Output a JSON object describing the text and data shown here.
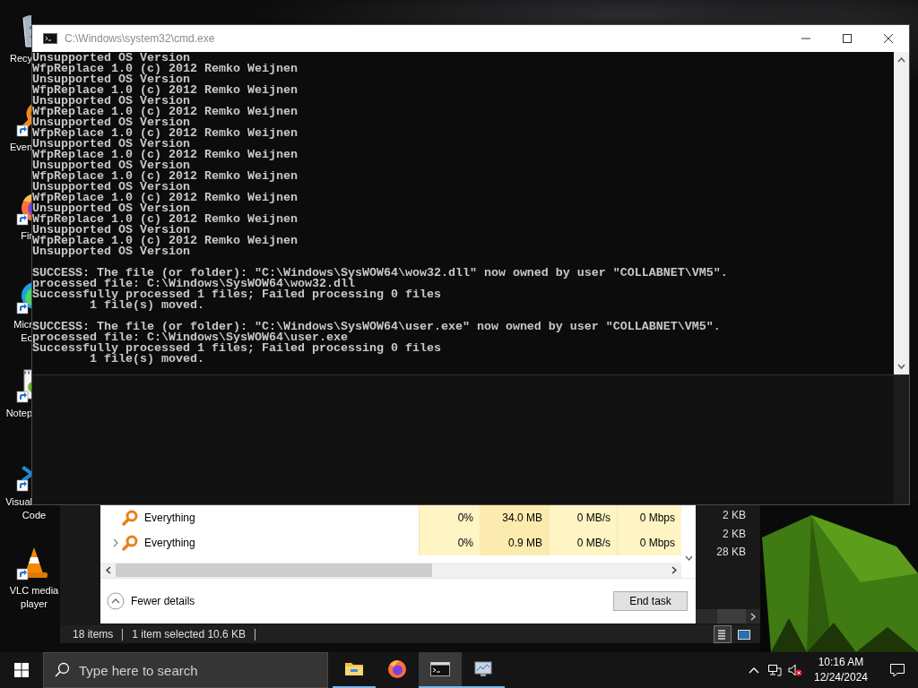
{
  "desktop_icons": [
    {
      "kind": "recycle-bin",
      "lines": [
        {
          "text": "Recy",
          "cut": true
        }
      ]
    },
    {
      "kind": "everything",
      "lines": [
        {
          "text": "Even",
          "cut": true
        }
      ]
    },
    {
      "kind": "firefox",
      "lines": [
        {
          "text": "Fir",
          "cut": true
        }
      ]
    },
    {
      "kind": "edge",
      "lines": [
        {
          "text": "Micr",
          "cut": true
        },
        {
          "text": "Ec",
          "cut": true
        }
      ]
    },
    {
      "kind": "notepad",
      "lines": [
        {
          "text": "Notep",
          "cut": true
        }
      ]
    },
    {
      "kind": "vscode",
      "lines": [
        {
          "text": "Visual",
          "cut": true
        },
        {
          "text": "Code",
          "cut": false
        }
      ]
    },
    {
      "kind": "vlc",
      "lines": [
        {
          "text": "VLC media",
          "cut": false
        },
        {
          "text": "player",
          "cut": false
        }
      ]
    }
  ],
  "cmd_window": {
    "title": "C:\\Windows\\system32\\cmd.exe",
    "blocks": [
      [
        "Unsupported OS Version",
        "WfpReplace 1.0 (c) 2012 Remko Weijnen",
        "Unsupported OS Version",
        "WfpReplace 1.0 (c) 2012 Remko Weijnen",
        "Unsupported OS Version",
        "WfpReplace 1.0 (c) 2012 Remko Weijnen",
        "Unsupported OS Version",
        "WfpReplace 1.0 (c) 2012 Remko Weijnen",
        "Unsupported OS Version",
        "WfpReplace 1.0 (c) 2012 Remko Weijnen",
        "Unsupported OS Version",
        "WfpReplace 1.0 (c) 2012 Remko Weijnen",
        "Unsupported OS Version",
        "WfpReplace 1.0 (c) 2012 Remko Weijnen",
        "Unsupported OS Version",
        "WfpReplace 1.0 (c) 2012 Remko Weijnen",
        "Unsupported OS Version",
        "WfpReplace 1.0 (c) 2012 Remko Weijnen",
        "Unsupported OS Version"
      ],
      [
        "SUCCESS: The file (or folder): \"C:\\Windows\\SysWOW64\\wow32.dll\" now owned by user \"COLLABNET\\VM5\".",
        "processed file: C:\\Windows\\SysWOW64\\wow32.dll",
        "Successfully processed 1 files; Failed processing 0 files",
        "        1 file(s) moved."
      ],
      [
        "SUCCESS: The file (or folder): \"C:\\Windows\\SysWOW64\\user.exe\" now owned by user \"COLLABNET\\VM5\".",
        "processed file: C:\\Windows\\SysWOW64\\user.exe",
        "Successfully processed 1 files; Failed processing 0 files",
        "        1 file(s) moved."
      ]
    ]
  },
  "explorer": {
    "sizes": [
      "2 KB",
      "2 KB",
      "28 KB"
    ],
    "status_bar": [
      "18 items",
      "1 item selected  10.6 KB"
    ],
    "views": [
      {
        "selected": true
      },
      {
        "selected": false
      }
    ]
  },
  "task_manager": {
    "rows": [
      {
        "name": "Everything",
        "expandable": false,
        "cpu": "0%",
        "memory": "34.0 MB",
        "disk": "0 MB/s",
        "network": "0 Mbps"
      },
      {
        "name": "Everything",
        "expandable": true,
        "cpu": "0%",
        "memory": "0.9 MB",
        "disk": "0 MB/s",
        "network": "0 Mbps"
      }
    ],
    "details_toggle": "Fewer details",
    "end_task": "End task"
  },
  "taskbar": {
    "search_placeholder": "Type here to search",
    "apps": [
      {
        "kind": "file-explorer",
        "running": true,
        "selected": false
      },
      {
        "kind": "firefox",
        "running": false,
        "selected": false
      },
      {
        "kind": "cmd",
        "running": true,
        "selected": true
      },
      {
        "kind": "monitor",
        "running": true,
        "selected": false
      }
    ],
    "time": "10:16 AM",
    "date": "12/24/2024"
  }
}
